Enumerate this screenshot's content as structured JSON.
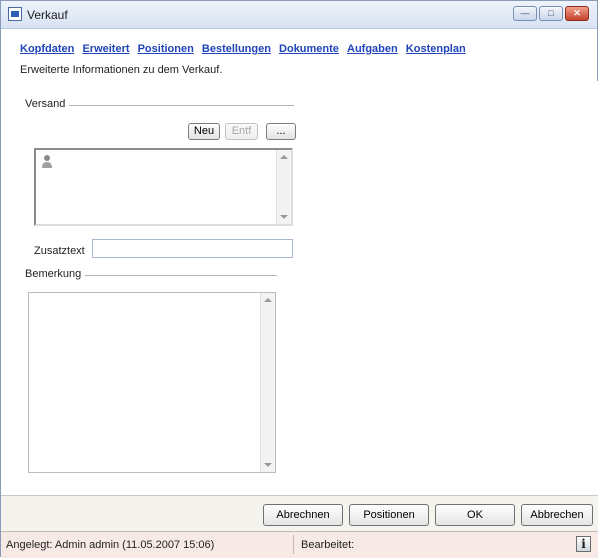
{
  "window": {
    "title": "Verkauf",
    "controls": {
      "minimize": "—",
      "maximize": "□",
      "close": "✕"
    }
  },
  "nav": {
    "items": [
      "Kopfdaten",
      "Erweitert",
      "Positionen",
      "Bestellungen",
      "Dokumente",
      "Aufgaben",
      "Kostenplan"
    ]
  },
  "header": {
    "subtitle": "Erweiterte Informationen zu dem Verkauf."
  },
  "versand": {
    "label": "Versand",
    "buttons": {
      "new": "Neu",
      "delete": "Entf",
      "more": "..."
    }
  },
  "zusatztext": {
    "label": "Zusatztext",
    "value": ""
  },
  "bemerkung": {
    "label": "Bemerkung",
    "value": ""
  },
  "footer": {
    "buttons": {
      "abrechnen": "Abrechnen",
      "positionen": "Positionen",
      "ok": "OK",
      "abbrechen": "Abbrechen"
    }
  },
  "status": {
    "created": "Angelegt: Admin admin (11.05.2007 15:06)",
    "edited": "Bearbeitet:",
    "info_icon": "i"
  }
}
